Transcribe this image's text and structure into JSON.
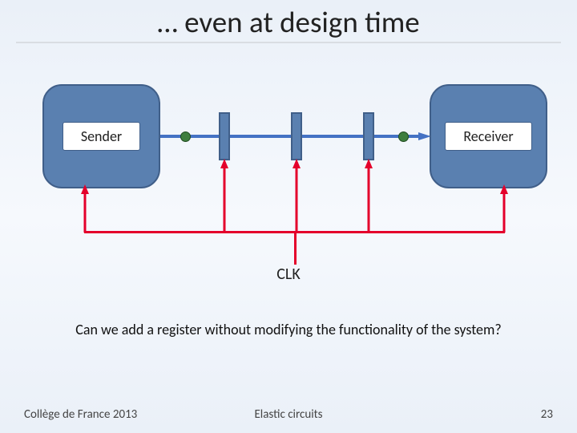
{
  "title": "… even at design time",
  "sender_label": "Sender",
  "receiver_label": "Receiver",
  "clk_label": "CLK",
  "question": "Can we add a register without modifying the functionality of the system?",
  "footer_left": "Collège de France 2013",
  "footer_center": "Elastic circuits",
  "footer_right": "23",
  "colors": {
    "node_fill": "#5a80b0",
    "node_border": "#405f89",
    "wire": "#e4002b",
    "dot": "#3e7e3e",
    "data_arrow": "#4472c4"
  }
}
